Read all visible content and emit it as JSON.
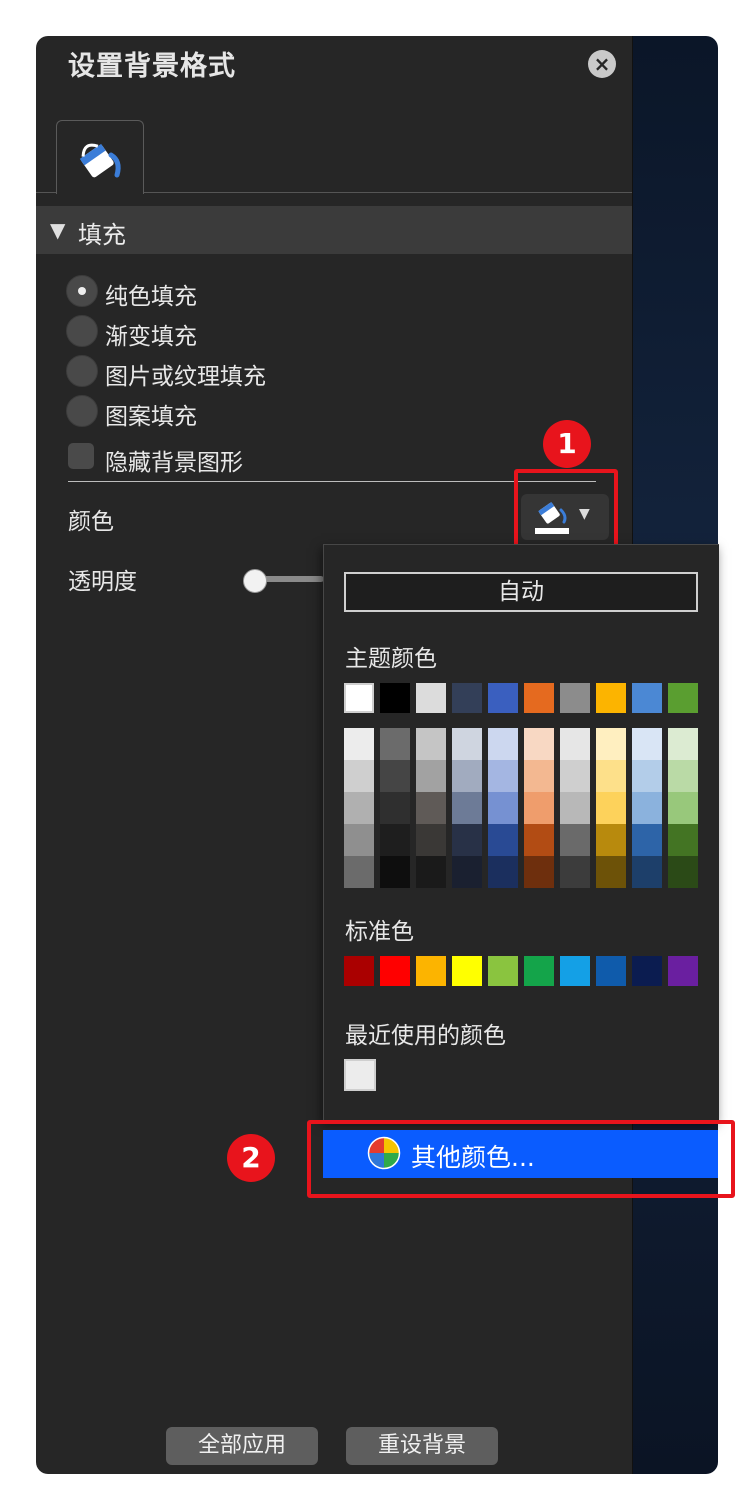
{
  "dialog": {
    "title": "设置背景格式",
    "section_label": "填充",
    "fill_options": [
      "纯色填充",
      "渐变填充",
      "图片或纹理填充",
      "图案填充"
    ],
    "selected_fill": "纯色填充",
    "hide_background_label": "隐藏背景图形",
    "color_label": "颜色",
    "transparency_label": "透明度",
    "transparency_value": 0,
    "apply_all_button": "全部应用",
    "reset_button": "重设背景"
  },
  "color_menu": {
    "auto_label": "自动",
    "theme_colors_label": "主题颜色",
    "theme_colors": [
      "#ffffff",
      "#000000",
      "#dcdcdc",
      "#333f58",
      "#3a5fbf",
      "#e56a1f",
      "#8c8c8c",
      "#fcb400",
      "#4b88d4",
      "#5a9e30"
    ],
    "theme_shades": [
      [
        "#ececec",
        "#cfcfcf",
        "#b0b0b0",
        "#8f8f8f",
        "#6b6b6b"
      ],
      [
        "#6b6b6b",
        "#454545",
        "#2f2f2f",
        "#1e1e1e",
        "#0e0e0e"
      ],
      [
        "#c5c5c5",
        "#a2a2a2",
        "#5f5a57",
        "#3a3836",
        "#1a1a1a"
      ],
      [
        "#cfd5e0",
        "#a1abbf",
        "#6d7b97",
        "#283147",
        "#1a2030"
      ],
      [
        "#ccd7ef",
        "#a4b6e2",
        "#7691d2",
        "#294a94",
        "#1b2f5e"
      ],
      [
        "#f8d8c3",
        "#f3b891",
        "#ef9d6c",
        "#b24c14",
        "#6e2f0d"
      ],
      [
        "#e6e6e6",
        "#cfcfcf",
        "#b8b8b8",
        "#6a6a6a",
        "#3c3c3c"
      ],
      [
        "#ffefc0",
        "#fde08a",
        "#fdd25b",
        "#b88a0d",
        "#6d5208"
      ],
      [
        "#d9e5f5",
        "#b3cde9",
        "#8bb2dd",
        "#2d64a8",
        "#1d3f6a"
      ],
      [
        "#dcebd2",
        "#badaa6",
        "#98c87b",
        "#437423",
        "#2b4a17"
      ]
    ],
    "standard_colors_label": "标准色",
    "standard_colors": [
      "#aa0000",
      "#ff0000",
      "#fcb400",
      "#ffff00",
      "#8ac43f",
      "#14a44a",
      "#14a0e6",
      "#0f5bab",
      "#0b1c50",
      "#6a1fa0"
    ],
    "recent_colors_label": "最近使用的颜色",
    "recent_colors": [
      "#ececec"
    ],
    "more_colors_label": "其他颜色..."
  },
  "annotations": {
    "badge_1": "1",
    "badge_2": "2"
  }
}
